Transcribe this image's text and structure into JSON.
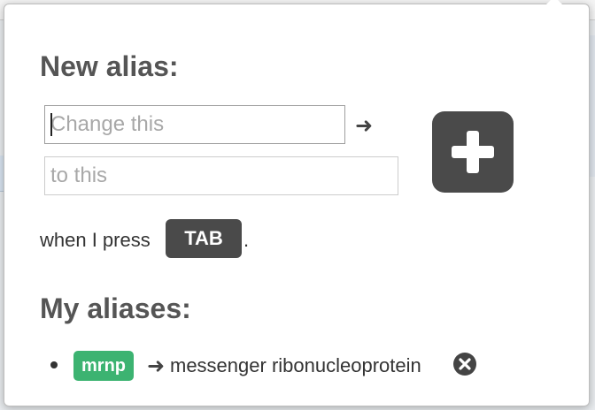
{
  "new_alias": {
    "heading": "New alias:",
    "from_placeholder": "Change this",
    "to_placeholder": "to this",
    "arrow_icon": "arrow-right-icon",
    "add_button_icon": "plus-icon",
    "colors": {
      "button_bg": "#4a4a4a",
      "badge_green": "#3cb371"
    }
  },
  "trigger": {
    "prefix": "when I press",
    "key": "TAB",
    "suffix": "."
  },
  "my_aliases": {
    "heading": "My aliases:",
    "items": [
      {
        "alias": "mrnp",
        "expansion": "messenger ribonucleoprotein",
        "remove_icon": "close-circle-icon"
      }
    ]
  }
}
